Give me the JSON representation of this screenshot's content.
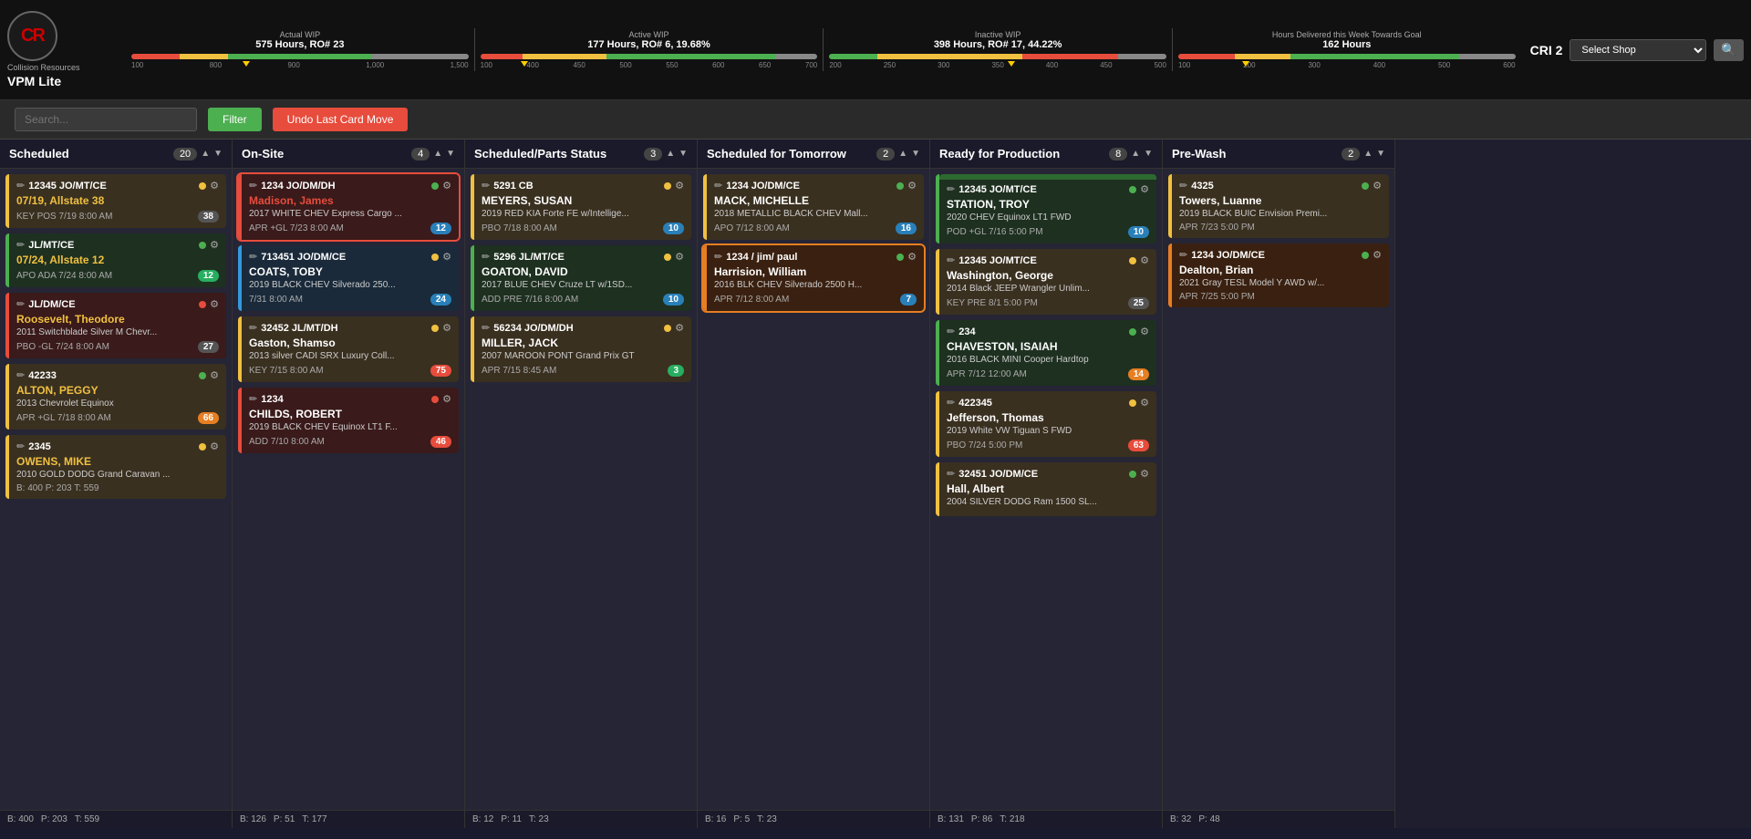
{
  "app": {
    "title": "VPM Lite",
    "logo": "CR",
    "logo_company": "Collision Resources"
  },
  "header": {
    "actual_wip": {
      "label": "Actual WIP",
      "value": "575 Hours, RO# 23",
      "gauge_markers": [
        "100",
        "800",
        "900",
        "1,000",
        "1,500"
      ],
      "arrow_pos": "35"
    },
    "active_wip": {
      "label": "Active WIP",
      "value": "177 Hours, RO# 6, 19.68%",
      "gauge_markers": [
        "100",
        "400",
        "450",
        "500",
        "550",
        "600",
        "650",
        "700"
      ],
      "arrow_pos": "15"
    },
    "inactive_wip": {
      "label": "Inactive WIP",
      "value": "398 Hours, RO# 17, 44.22%",
      "gauge_markers": [
        "200",
        "250",
        "300",
        "350",
        "400",
        "450",
        "500"
      ],
      "arrow_pos": "55"
    },
    "hours_goal": {
      "label": "Hours Delivered this Week Towards Goal",
      "value": "162 Hours",
      "gauge_markers": [
        "100",
        "200",
        "300",
        "400",
        "500",
        "600"
      ],
      "arrow_pos": "20"
    },
    "cri": "CRI 2",
    "shop_select_placeholder": "Select Shop",
    "search_btn": "🔍"
  },
  "toolbar": {
    "search_placeholder": "Search...",
    "filter_label": "Filter",
    "undo_label": "Undo Last Card Move"
  },
  "columns": [
    {
      "id": "scheduled",
      "title": "Scheduled",
      "count": 20,
      "cards": [
        {
          "id": "12345 JO/MT/CE",
          "name": "07/19, Allstate 38",
          "vehicle": "",
          "date": "KEY  POS  7/19 8:00 AM",
          "badge": "38",
          "badge_type": "gray",
          "dot": "yellow",
          "border": "yellow",
          "name_color": "yellow"
        },
        {
          "id": "JL/MT/CE",
          "name": "07/24, Allstate 12",
          "vehicle": "",
          "date": "APO  ADA  7/24 8:00 AM",
          "badge": "12",
          "badge_type": "green",
          "dot": "green",
          "border": "green",
          "name_color": "yellow"
        },
        {
          "id": "JL/DM/CE",
          "name": "Roosevelt, Theodore",
          "vehicle": "2011 Switchblade Silver M Chevr...",
          "date": "PBO  -GL  7/24 8:00 AM",
          "badge": "27",
          "badge_type": "gray",
          "dot": "red",
          "border": "red",
          "name_color": "yellow"
        },
        {
          "id": "42233",
          "name": "ALTON, PEGGY",
          "vehicle": "2013 Chevrolet Equinox",
          "date": "APR  +GL  7/18 8:00 AM",
          "badge": "66",
          "badge_type": "yellow",
          "dot": "green",
          "border": "yellow",
          "name_color": "yellow"
        },
        {
          "id": "2345",
          "name": "OWENS, MIKE",
          "vehicle": "2010 GOLD DODG Grand Caravan ...",
          "date": "B: 400   P: 203   T: 559",
          "badge": "",
          "badge_type": "",
          "dot": "yellow",
          "border": "yellow",
          "name_color": "yellow"
        }
      ],
      "footer": {
        "b": "B: 400",
        "p": "P: 203",
        "t": "T: 559"
      }
    },
    {
      "id": "on-site",
      "title": "On-Site",
      "count": 4,
      "cards": [
        {
          "id": "1234 JO/DM/DH",
          "name": "Madison, James",
          "vehicle": "2017 WHITE CHEV Express Cargo ...",
          "date": "APR  +GL  7/23 8:00 AM",
          "badge": "12",
          "badge_type": "blue",
          "dot": "green",
          "border": "red",
          "name_color": "red",
          "highlighted": true
        },
        {
          "id": "713451 JO/DM/CE",
          "name": "COATS, TOBY",
          "vehicle": "2019 BLACK CHEV Silverado 250...",
          "date": "7/31 8:00 AM",
          "badge": "24",
          "badge_type": "blue",
          "dot": "yellow",
          "border": "blue",
          "name_color": "white"
        },
        {
          "id": "32452 JL/MT/DH",
          "name": "Gaston, Shamso",
          "vehicle": "2013 silver CADI SRX Luxury Coll...",
          "date": "KEY   7/15 8:00 AM",
          "badge": "75",
          "badge_type": "red",
          "dot": "yellow",
          "border": "yellow",
          "name_color": "white"
        },
        {
          "id": "1234",
          "name": "CHILDS, ROBERT",
          "vehicle": "2019 BLACK CHEV Equinox LT1 F...",
          "date": "ADD  7/10 8:00 AM",
          "badge": "46",
          "badge_type": "red",
          "dot": "red",
          "border": "red",
          "name_color": "white"
        }
      ],
      "footer": {
        "b": "B: 126",
        "p": "P: 51",
        "t": "T: 177"
      }
    },
    {
      "id": "scheduled-parts",
      "title": "Scheduled/Parts Status",
      "count": 3,
      "cards": [
        {
          "id": "5291 CB",
          "name": "MEYERS, SUSAN",
          "vehicle": "2019 RED KIA Forte FE w/Intellige...",
          "date": "PBO  7/18 8:00 AM",
          "badge": "10",
          "badge_type": "blue",
          "dot": "yellow",
          "border": "yellow",
          "name_color": "white"
        },
        {
          "id": "5296 JL/MT/CE",
          "name": "GOATON, DAVID",
          "vehicle": "2017 BLUE CHEV Cruze LT w/1SD...",
          "date": "ADD  PRE  7/16 8:00 AM",
          "badge": "10",
          "badge_type": "blue",
          "dot": "yellow",
          "border": "green",
          "name_color": "white"
        },
        {
          "id": "56234 JO/DM/DH",
          "name": "MILLER, JACK",
          "vehicle": "2007 MAROON PONT Grand Prix GT",
          "date": "APR  7/15 8:45 AM",
          "badge": "3",
          "badge_type": "green",
          "dot": "yellow",
          "border": "yellow",
          "name_color": "white"
        }
      ],
      "footer": {
        "b": "B: 12",
        "p": "P: 11",
        "t": "T: 23"
      }
    },
    {
      "id": "scheduled-tomorrow",
      "title": "Scheduled for Tomorrow",
      "count": 2,
      "cards": [
        {
          "id": "1234 JO/DM/CE",
          "name": "MACK, MICHELLE",
          "vehicle": "2018 METALLIC BLACK CHEV Mall...",
          "date": "APO  7/12 8:00 AM",
          "badge": "16",
          "badge_type": "blue",
          "dot": "green",
          "border": "yellow",
          "name_color": "white"
        },
        {
          "id": "1234 / jim/ paul",
          "name": "Harrision, William",
          "vehicle": "2016 BLK CHEV Silverado 2500 H...",
          "date": "APR  7/12 8:00 AM",
          "badge": "7",
          "badge_type": "blue",
          "dot": "green",
          "border": "orange",
          "name_color": "white",
          "highlighted": true
        }
      ],
      "footer": {
        "b": "B: 16",
        "p": "P: 5",
        "t": "T: 23"
      }
    },
    {
      "id": "ready-production",
      "title": "Ready for Production",
      "count": 8,
      "cards": [
        {
          "id": "12345 JO/MT/CE",
          "name": "STATION, TROY",
          "vehicle": "2020  CHEV Equinox LT1 FWD",
          "date": "POD  +GL  7/16 5:00 PM",
          "badge": "10",
          "badge_type": "blue",
          "dot": "green",
          "border": "green",
          "name_color": "white",
          "green_header": true
        },
        {
          "id": "12345 JO/MT/CE",
          "name": "Washington, George",
          "vehicle": "2014 Black JEEP Wrangler Unlim...",
          "date": "KEY  PRE  8/1 5:00 PM",
          "badge": "25",
          "badge_type": "gray",
          "dot": "yellow",
          "border": "yellow",
          "name_color": "white"
        },
        {
          "id": "234",
          "name": "CHAVESTON, ISAIAH",
          "vehicle": "2016 BLACK MINI Cooper Hardtop",
          "date": "APR  7/12 12:00 AM",
          "badge": "14",
          "badge_type": "orange",
          "dot": "green",
          "border": "green",
          "name_color": "white"
        },
        {
          "id": "422345",
          "name": "Jefferson, Thomas",
          "vehicle": "2019 White VW Tiguan S FWD",
          "date": "PBO  7/24 5:00 PM",
          "badge": "63",
          "badge_type": "red",
          "dot": "yellow",
          "border": "yellow",
          "name_color": "white"
        },
        {
          "id": "32451 JO/DM/CE",
          "name": "Hall, Albert",
          "vehicle": "2004 SILVER DODG Ram 1500 SL...",
          "date": "",
          "badge": "",
          "badge_type": "",
          "dot": "green",
          "border": "yellow",
          "name_color": "white"
        }
      ],
      "footer": {
        "b": "B: 131",
        "p": "P: 86",
        "t": "T: 218"
      }
    },
    {
      "id": "pre-wash",
      "title": "Pre-Wash",
      "count": 2,
      "cards": [
        {
          "id": "4325",
          "name": "Towers, Luanne",
          "vehicle": "2019 BLACK BUIC Envision Premi...",
          "date": "APR  7/23 5:00 PM",
          "badge": "",
          "badge_type": "",
          "dot": "green",
          "border": "yellow",
          "name_color": "white"
        },
        {
          "id": "1234 JO/DM/CE",
          "name": "Dealton, Brian",
          "vehicle": "2021 Gray TESL Model Y AWD w/...",
          "date": "APR  7/25 5:00 PM",
          "badge": "",
          "badge_type": "",
          "dot": "green",
          "border": "orange",
          "name_color": "white"
        }
      ],
      "footer": {
        "b": "B: 32",
        "p": "P: 48",
        "t": ""
      }
    }
  ]
}
